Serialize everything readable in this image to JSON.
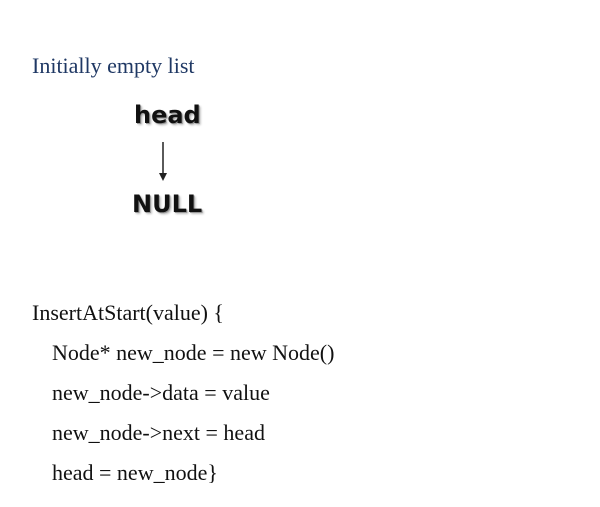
{
  "caption": "Initially empty list",
  "diagram": {
    "head_label": "head",
    "null_label": "NULL",
    "arrow_icon": "arrow-down-icon"
  },
  "code": {
    "lines": [
      "InsertAtStart(value) {",
      "Node* new_node = new Node()",
      "new_node->data = value",
      "new_node->next = head",
      "head = new_node}"
    ]
  }
}
